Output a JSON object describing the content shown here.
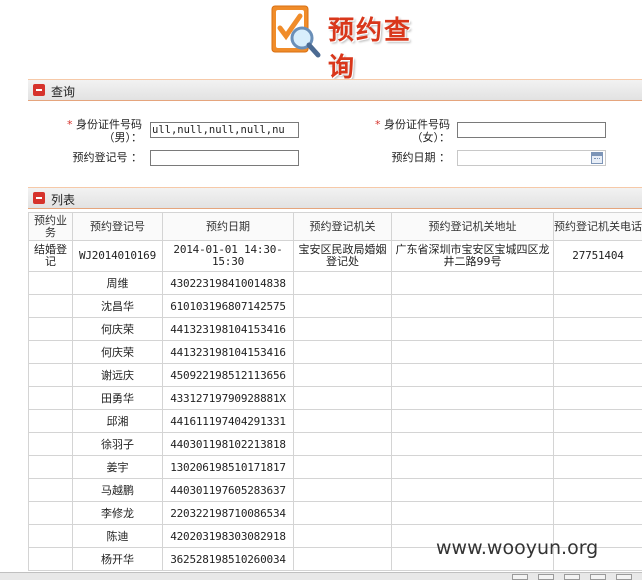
{
  "header": {
    "title": "预约查询"
  },
  "query_section": {
    "title": "查询",
    "id_male_label_line1": "身份证件号码",
    "id_male_label_line2": "（男）：",
    "id_male_value": "ull,null,null,null,nu",
    "id_female_label_line1": "身份证件号码",
    "id_female_label_line2": "（女）：",
    "id_female_value": "",
    "booking_no_label": "预约登记号 ：",
    "booking_no_value": "",
    "booking_date_label": "预约日期 ：",
    "booking_date_value": "",
    "required_mark": "*"
  },
  "list_section": {
    "title": "列表",
    "columns": [
      "预约业务",
      "预约登记号",
      "预约日期",
      "预约登记机关",
      "预约登记机关地址",
      "预约登记机关电话"
    ],
    "first_row": {
      "business": "结婚登记",
      "booking_no": "WJ2014010169",
      "date": "2014-01-01 14:30-15:30",
      "office": "宝安区民政局婚姻登记处",
      "address": "广东省深圳市宝安区宝城四区龙井二路99号",
      "phone": "27751404"
    },
    "rows": [
      {
        "name": "周维",
        "id": "430223198410014838"
      },
      {
        "name": "沈昌华",
        "id": "610103196807142575"
      },
      {
        "name": "何庆荣",
        "id": "441323198104153416"
      },
      {
        "name": "何庆荣",
        "id": "441323198104153416"
      },
      {
        "name": "谢远庆",
        "id": "450922198512113656"
      },
      {
        "name": "田勇华",
        "id": "43312719790928881X"
      },
      {
        "name": "邱湘",
        "id": "441611197404291331"
      },
      {
        "name": "徐羽子",
        "id": "440301198102213818"
      },
      {
        "name": "姜宇",
        "id": "130206198510171817"
      },
      {
        "name": "马越鹏",
        "id": "440301197605283637"
      },
      {
        "name": "李修龙",
        "id": "220322198710086534"
      },
      {
        "name": "陈迪",
        "id": "420203198303082918"
      },
      {
        "name": "杨开华",
        "id": "362528198510260034"
      }
    ]
  },
  "watermark": "www.wooyun.org",
  "icons": {
    "logo": "document-search-icon",
    "collapse": "minus-icon",
    "calendar": "calendar-icon"
  }
}
